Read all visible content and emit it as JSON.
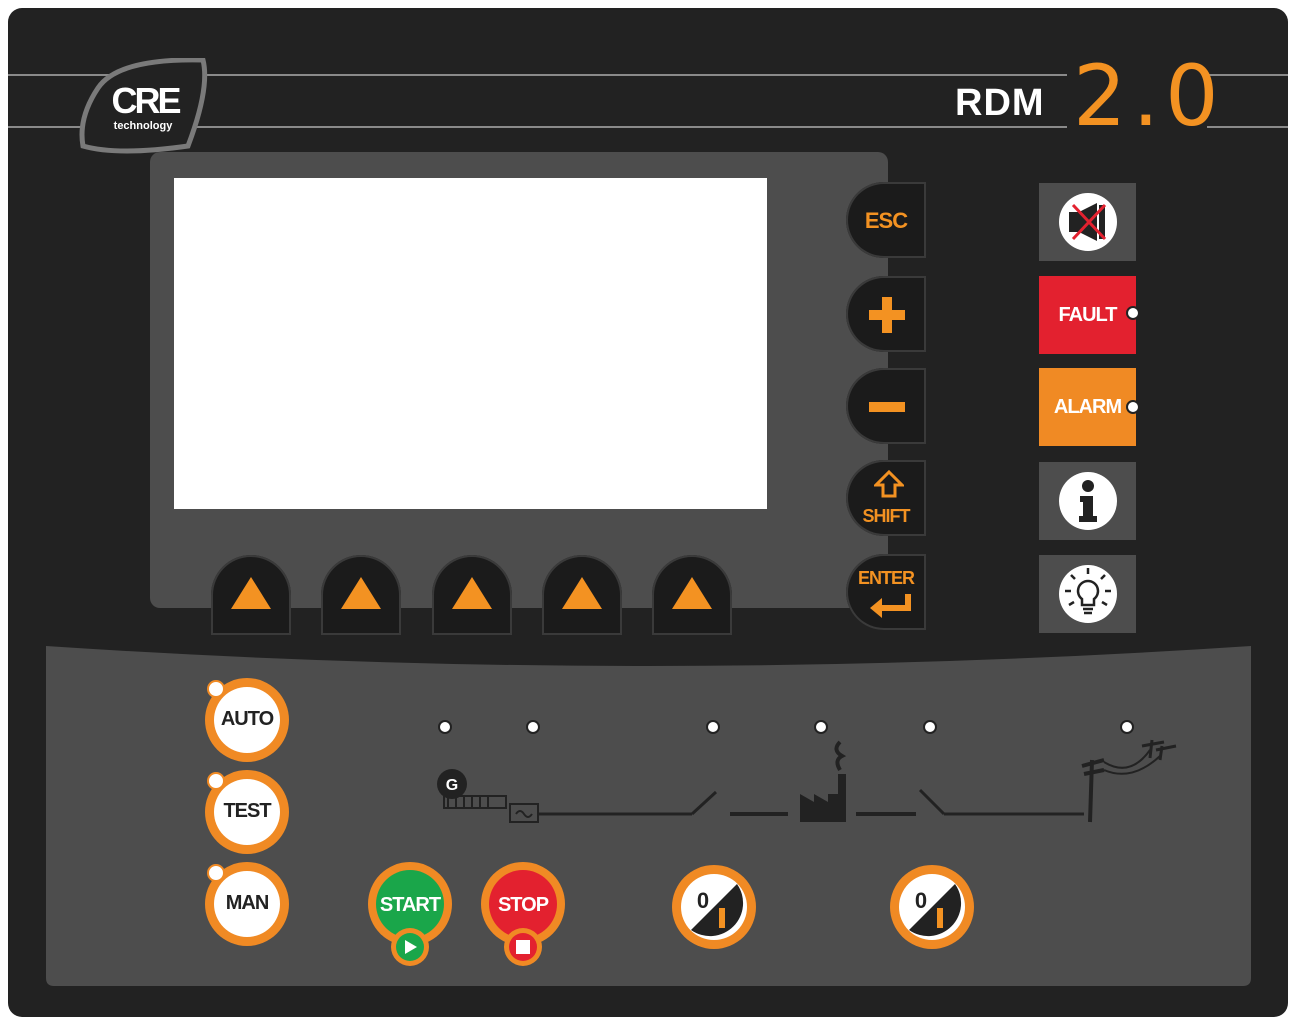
{
  "logo": {
    "mark": "CRE",
    "sub": "technology"
  },
  "brand": {
    "model": "RDM",
    "version": "2.0"
  },
  "nav_keys": [
    {
      "label": "ESC"
    },
    {
      "label": "+"
    },
    {
      "label": "−"
    },
    {
      "label": "SHIFT"
    },
    {
      "label": "ENTER"
    }
  ],
  "right_keys": {
    "horn_icon": "horn-mute-icon",
    "fault": "FAULT",
    "alarm": "ALARM",
    "info_icon": "info-icon",
    "lamp_icon": "lamp-test-icon"
  },
  "modes": [
    "AUTO",
    "TEST",
    "MAN"
  ],
  "control_buttons": {
    "start": "START",
    "stop": "STOP"
  },
  "breaker_label": "0 / I",
  "generator_label": "G",
  "colors": {
    "accent": "#f39222",
    "fault": "#e3212f",
    "alarm": "#f08a24",
    "start": "#1aa64a",
    "stop": "#e3212f",
    "panel": "#222222",
    "face": "#4d4d4d"
  }
}
